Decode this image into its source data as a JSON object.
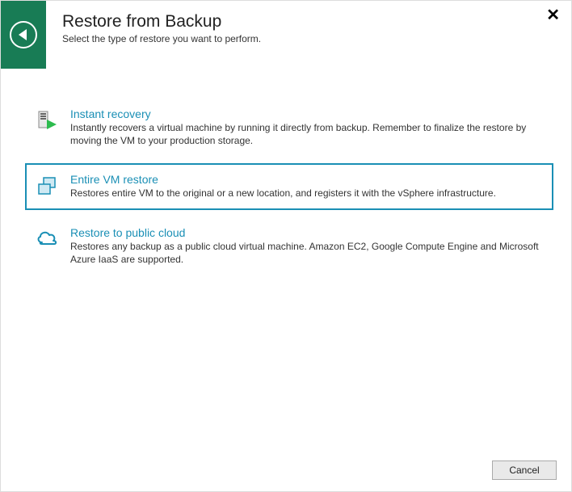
{
  "header": {
    "title": "Restore from Backup",
    "subtitle": "Select the type of restore you want to perform."
  },
  "options": [
    {
      "id": "instant-recovery",
      "title": "Instant recovery",
      "description": "Instantly recovers a virtual machine by running it directly from backup. Remember to finalize the restore by moving the VM to your production storage.",
      "selected": false
    },
    {
      "id": "entire-vm-restore",
      "title": "Entire VM restore",
      "description": "Restores entire VM to the original or a new location, and registers it with the vSphere infrastructure.",
      "selected": true
    },
    {
      "id": "restore-public-cloud",
      "title": "Restore to public cloud",
      "description": "Restores any backup as a public cloud virtual machine. Amazon EC2, Google Compute Engine and Microsoft Azure IaaS are supported.",
      "selected": false
    }
  ],
  "buttons": {
    "cancel": "Cancel"
  }
}
